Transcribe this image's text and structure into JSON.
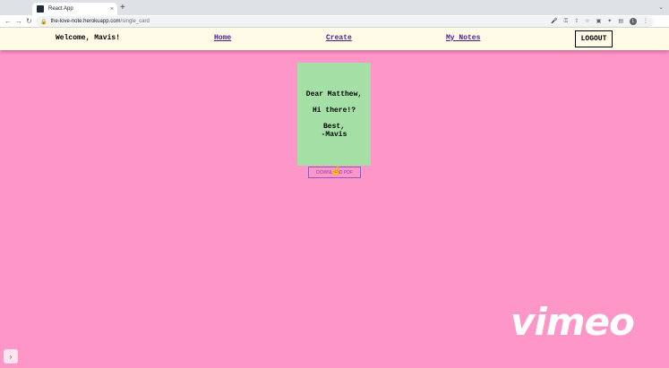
{
  "browser": {
    "tab_title": "React App",
    "tab_close": "×",
    "new_tab": "+",
    "tab_menu": "⌄",
    "back": "←",
    "forward": "→",
    "reload": "↻",
    "url_host": "the-love-note.herokuapp.com",
    "url_path": "/single_card",
    "avatar_letter": "L"
  },
  "navbar": {
    "welcome": "Welcome, Mavis!",
    "home": "Home",
    "create": "Create",
    "my_notes": "My Notes",
    "logout": "LOGOUT"
  },
  "card": {
    "greeting": "Dear Matthew,",
    "message": "Hi there!?",
    "closing": "Best,",
    "signature": "-Mavis",
    "background": "#a4e0a6"
  },
  "download_button": "DOWNLOAD PDF",
  "overlay": {
    "vimeo_logo": "vimeo",
    "side_button": "›"
  },
  "colors": {
    "page_background": "#ff96c8",
    "navbar_background": "#fffbe6",
    "link": "#4a1e8a"
  }
}
